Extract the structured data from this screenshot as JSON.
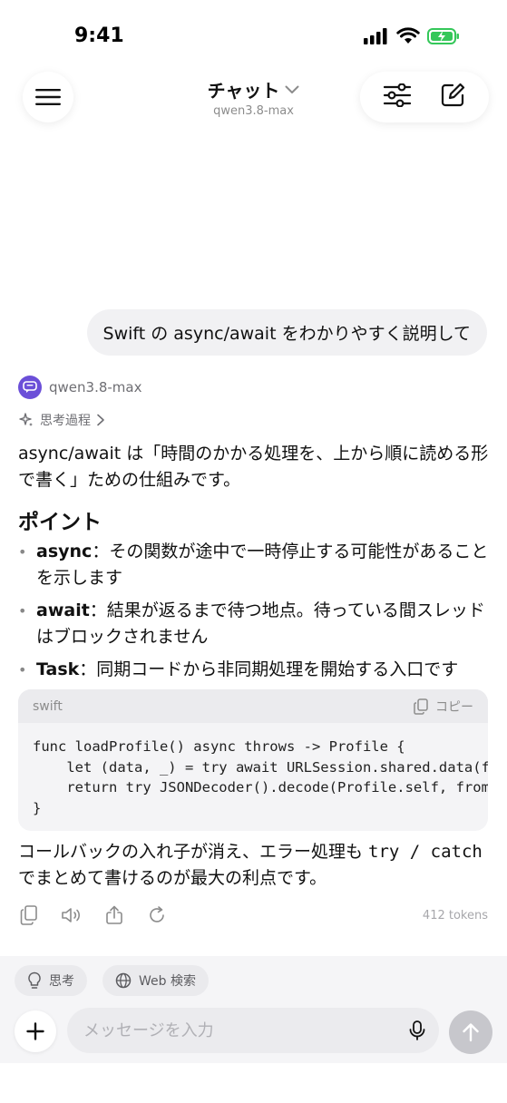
{
  "status_bar": {
    "time": "9:41"
  },
  "header": {
    "title": "チャット",
    "subtitle": "qwen3.8-max"
  },
  "user_message": "Swift の async/await をわかりやすく説明して",
  "assistant": {
    "model_name": "qwen3.8-max",
    "thinking_label": "思考過程",
    "intro": "async/await は「時間のかかる処理を、上から順に読める形で書く」ための仕組みです。",
    "heading": "ポイント",
    "bullets": [
      {
        "term": "async",
        "text": "：その関数が途中で一時停止する可能性があることを示します"
      },
      {
        "term": "await",
        "text": "：結果が返るまで待つ地点。待っている間スレッドはブロックされません"
      },
      {
        "term": "Task",
        "text": "：同期コードから非同期処理を開始する入口です"
      }
    ],
    "code": {
      "language": "swift",
      "copy_label": "コピー",
      "lines": [
        "func loadProfile() async throws -> Profile {",
        "    let (data, _) = try await URLSession.shared.data(from: url)",
        "    return try JSONDecoder().decode(Profile.self, from: data)",
        "}"
      ]
    },
    "outro_pre": "コールバックの入れ子が消え、エラー処理も ",
    "outro_code": "try / catch",
    "outro_post": " でまとめて書けるのが最大の利点です。",
    "tokens": "412 tokens"
  },
  "composer": {
    "chip_think": "思考",
    "chip_web": "Web 検索",
    "placeholder": "メッセージを入力"
  },
  "colors": {
    "avatar": "#6b4fd8",
    "battery": "#34c759",
    "send_disabled": "#c7c7cc"
  },
  "icons": [
    "signal-icon",
    "wifi-icon",
    "battery-icon",
    "menu-icon",
    "chevron-down-icon",
    "sliders-icon",
    "compose-icon",
    "sparkle-icon",
    "chevron-right-icon",
    "copy-icon",
    "speaker-icon",
    "share-icon",
    "regenerate-icon",
    "lightbulb-icon",
    "globe-icon",
    "plus-icon",
    "mic-icon",
    "arrow-up-icon"
  ]
}
